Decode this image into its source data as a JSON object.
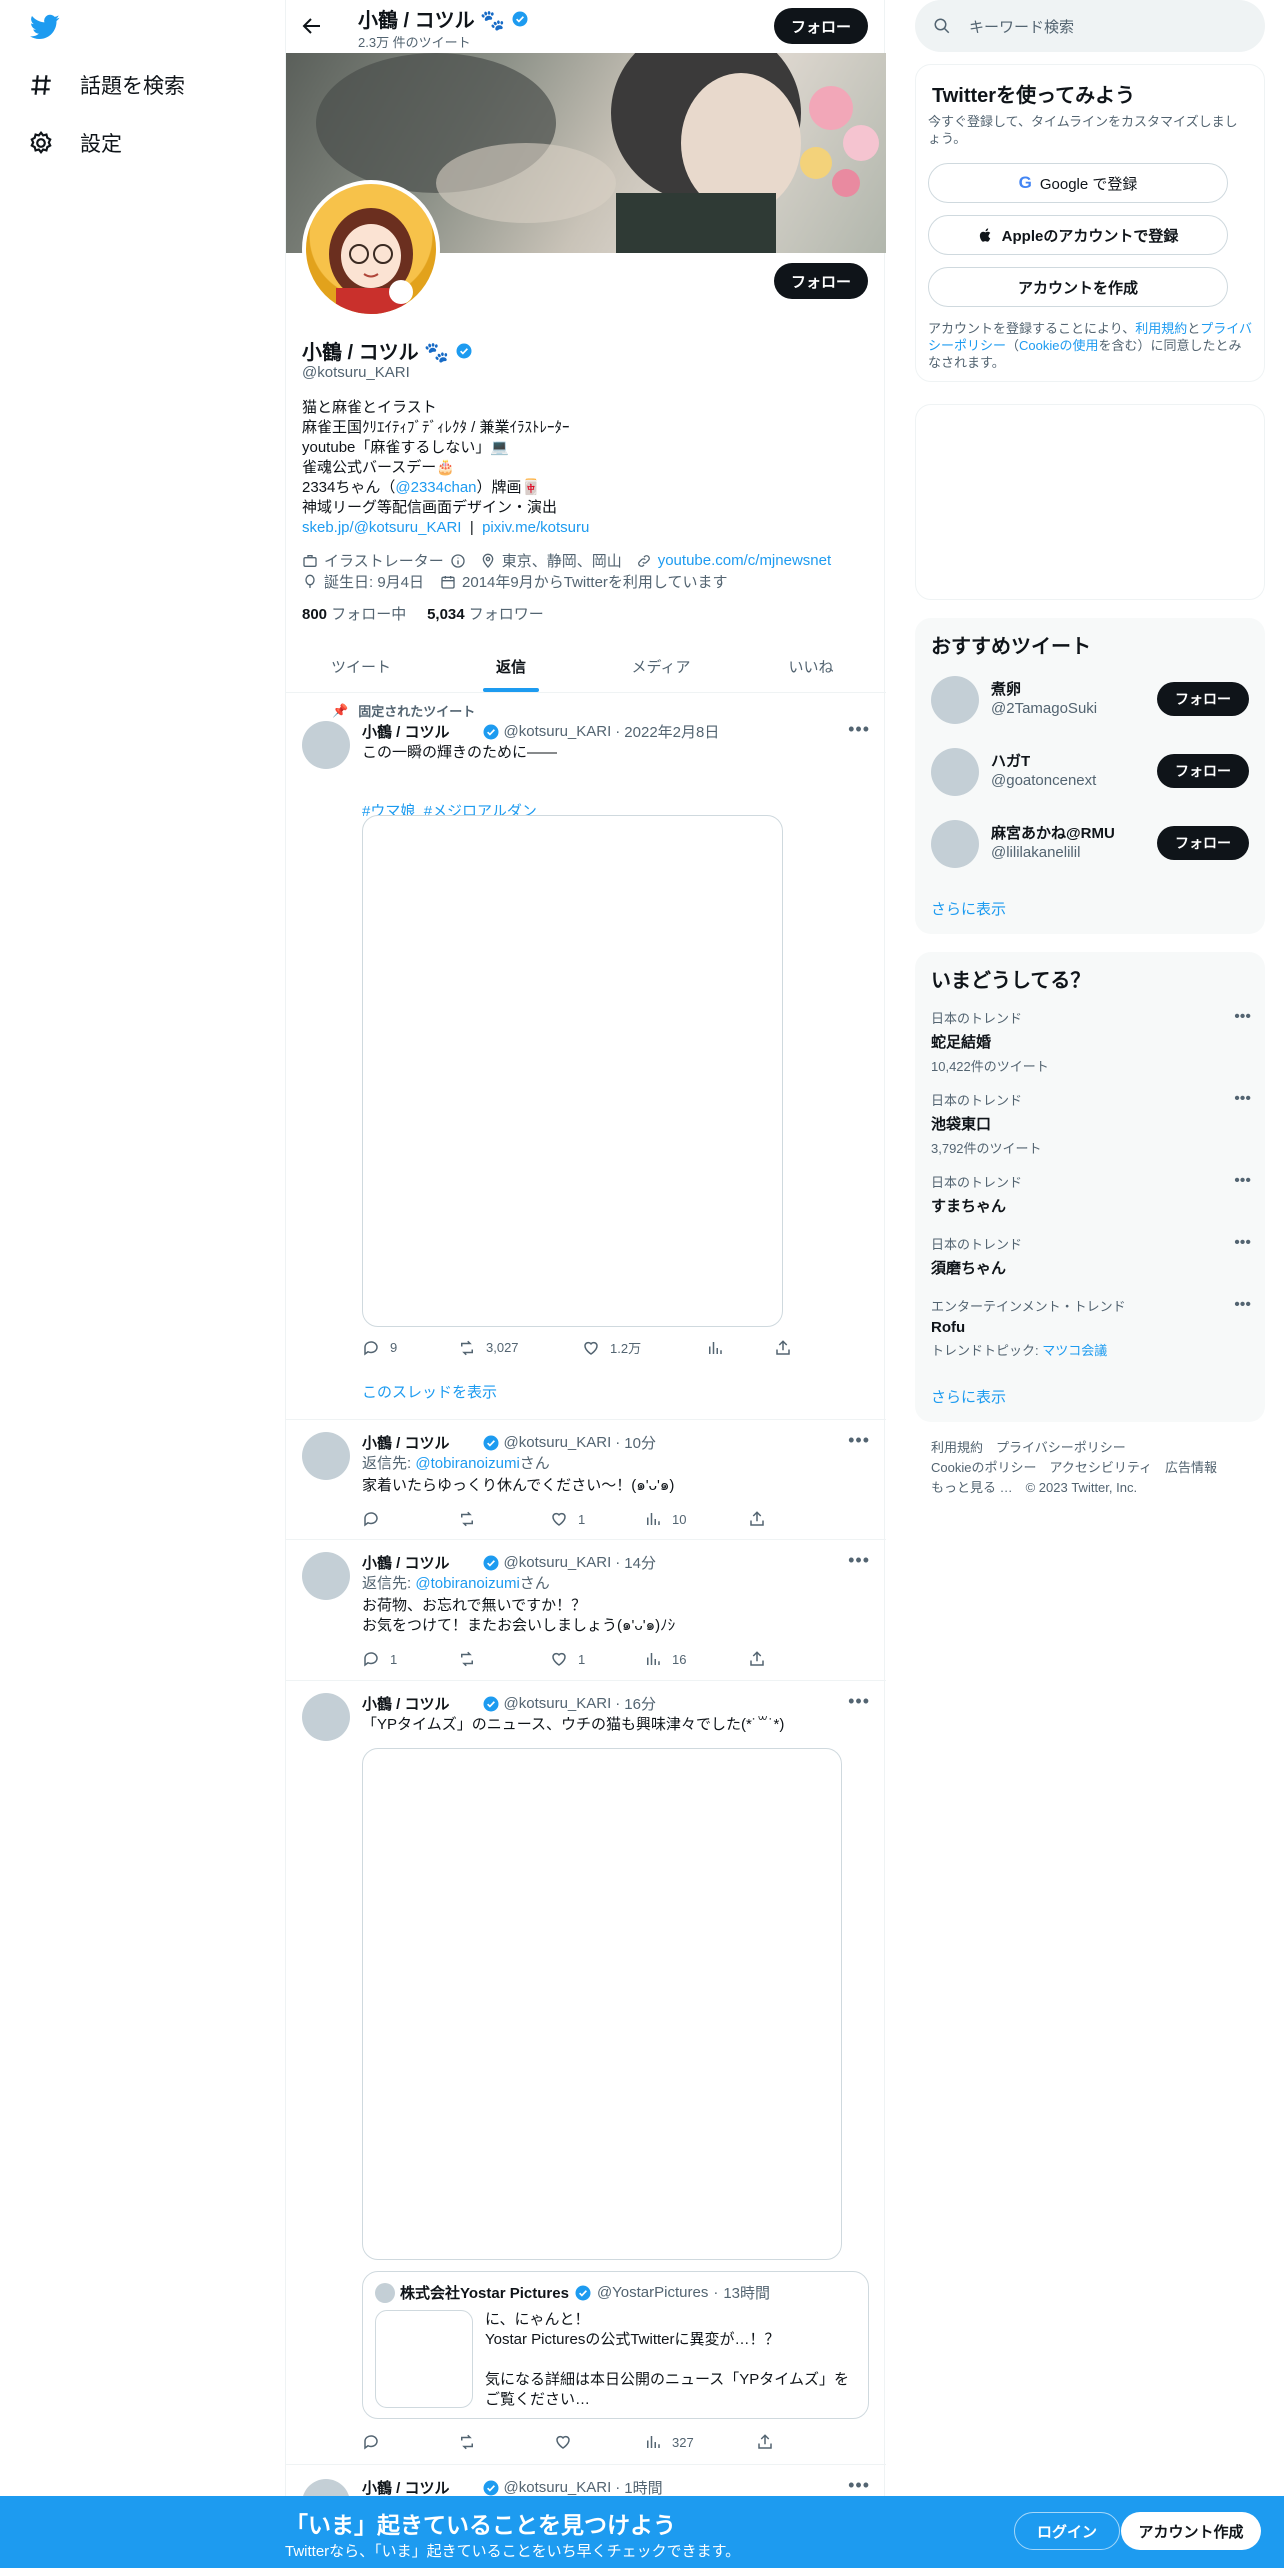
{
  "nav": {
    "explore_label": "話題を検索",
    "settings_label": "設定"
  },
  "header": {
    "name": "小鶴 / コツル 🐾",
    "tweet_count": "2.3万 件のツイート",
    "follow_label": "フォロー"
  },
  "profile": {
    "name": "小鶴 / コツル 🐾",
    "handle": "@kotsuru_KARI",
    "follow_label": "フォロー",
    "bio_lines": [
      "猫と麻雀とイラスト",
      "麻雀王国ｸﾘｴｲﾃｨﾌﾞﾃﾞｨﾚｸﾀ / 兼業ｲﾗｽﾄﾚｰﾀｰ",
      "youtube「麻雀するしない」💻",
      "雀魂公式バースデー🎂"
    ],
    "bio_line5_pre": "2334ちゃん（",
    "bio_line5_link": "@2334chan",
    "bio_line5_post": "）牌画🀄",
    "bio_line6": "神域リーグ等配信画面デザイン・演出",
    "bio_link1": "skeb.jp/@kotsuru_KARI",
    "bio_sep": "|",
    "bio_link2": "pixiv.me/kotsuru",
    "category": "イラストレーター",
    "location": "東京、静岡、岡山",
    "website": "youtube.com/c/mjnewsnet",
    "birthday": "誕生日: 9月4日",
    "joined": "2014年9月からTwitterを利用しています",
    "following_count": "800",
    "following_label": "フォロー中",
    "followers_count": "5,034",
    "followers_label": "フォロワー"
  },
  "tabs": [
    "ツイート",
    "返信",
    "メディア",
    "いいね"
  ],
  "tweets": [
    {
      "pinned_label": "固定されたツイート",
      "name": "小鶴 / コツル",
      "handle": "@kotsuru_KARI",
      "time": "2022年2月8日",
      "text": "この一瞬の輝きのために――",
      "hashtag1": "#ウマ娘",
      "hashtag2": "#メジロアルダン",
      "replies": "9",
      "retweets": "3,027",
      "likes": "1.2万",
      "views": "",
      "show_thread": "このスレッドを表示"
    },
    {
      "name": "小鶴 / コツル",
      "handle": "@kotsuru_KARI",
      "time": "10分",
      "reply_to_label": "返信先: ",
      "reply_to": "@tobiranoizumi",
      "reply_suffix": "さん",
      "text": "家着いたらゆっくり休んでください〜！(๑'ᴗ'๑)",
      "replies": "",
      "retweets": "",
      "likes": "1",
      "views": "10"
    },
    {
      "name": "小鶴 / コツル",
      "handle": "@kotsuru_KARI",
      "time": "14分",
      "reply_to_label": "返信先: ",
      "reply_to": "@tobiranoizumi",
      "reply_suffix": "さん",
      "text": "お荷物、お忘れで無いですか！？\nお気をつけて！またお会いしましょう(๑'ᴗ'๑)ﾉｼ",
      "replies": "1",
      "retweets": "",
      "likes": "1",
      "views": "16"
    },
    {
      "name": "小鶴 / コツル",
      "handle": "@kotsuru_KARI",
      "time": "16分",
      "text": "「YPタイムズ」のニュース、ウチの猫も興味津々でした(*˙꒳˙*)",
      "quote_name": "株式会社Yostar Pictures",
      "quote_handle": "@YostarPictures",
      "quote_time": "13時間",
      "quote_text": "に、にゃんと！\nYostar Picturesの公式Twitterに異変が…！？\n\n気になる詳細は本日公開のニュース「YPタイムズ」をご覧ください…",
      "replies": "",
      "retweets": "",
      "likes": "",
      "views": "327"
    },
    {
      "name": "小鶴 / コツル",
      "handle": "@kotsuru_KARI",
      "time": "1時間"
    }
  ],
  "right": {
    "search_placeholder": "キーワード検索",
    "signup_title": "Twitterを使ってみよう",
    "signup_sub": "今すぐ登録して、タイムラインをカスタマイズしましょう。",
    "google_label": "Google で登録",
    "apple_label": "Appleのアカウントで登録",
    "create_label": "アカウントを作成",
    "terms_pre": "アカウントを登録することにより、",
    "terms_link": "利用規約",
    "terms_and": "と",
    "privacy_link": "プライバシーポリシー",
    "cookie_pre": "（",
    "cookie_link": "Cookieの使用",
    "cookie_post": "を含む）に同意したとみなされます。",
    "suggest_title": "おすすめツイート",
    "suggestions": [
      {
        "name": "煮卵",
        "handle": "@2TamagoSuki",
        "button": "フォロー"
      },
      {
        "name": "ハガT",
        "handle": "@goatoncenext",
        "button": "フォロー"
      },
      {
        "name": "麻宮あかね@RMU",
        "handle": "@lililakanelilil",
        "button": "フォロー"
      }
    ],
    "show_more": "さらに表示",
    "trends_title": "いまどうしてる？",
    "trends": [
      {
        "context": "日本のトレンド",
        "title": "蛇足結婚",
        "sub": "10,422件のツイート"
      },
      {
        "context": "日本のトレンド",
        "title": "池袋東口",
        "sub": "3,792件のツイート"
      },
      {
        "context": "日本のトレンド",
        "title": "すまちゃん",
        "sub": ""
      },
      {
        "context": "日本のトレンド",
        "title": "須磨ちゃん",
        "sub": ""
      },
      {
        "context": "エンターテインメント・トレンド",
        "title": "Rofu",
        "sub_pre": "トレンドトピック: ",
        "sub_link": "マツコ会議"
      }
    ],
    "trends_more": "さらに表示",
    "footer_line1": "利用規約　プライバシーポリシー",
    "footer_line2": "Cookieのポリシー　アクセシビリティ　広告情報",
    "footer_line3": "もっと見る …　© 2023 Twitter, Inc."
  },
  "bottom": {
    "title": "「いま」起きていることを見つけよう",
    "sub": "Twitterなら、「いま」起きていることをいち早くチェックできます。",
    "login": "ログイン",
    "signup": "アカウント作成"
  },
  "colors": {
    "accent": "#1d9bf0",
    "text": "#0f1419",
    "secondary": "#536471"
  }
}
